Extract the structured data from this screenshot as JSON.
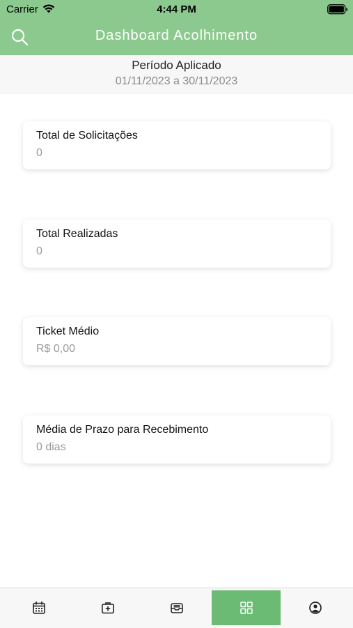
{
  "status_bar": {
    "carrier": "Carrier",
    "time": "4:44 PM"
  },
  "header": {
    "title": "Dashboard Acolhimento",
    "search_icon": "search-icon",
    "background_color": "#8cc98e"
  },
  "period": {
    "label": "Período Aplicado",
    "range": "01/11/2023 a 30/11/2023"
  },
  "cards": [
    {
      "title": "Total de Solicitações",
      "value": "0"
    },
    {
      "title": "Total Realizadas",
      "value": "0"
    },
    {
      "title": "Ticket Médio",
      "value": "R$ 0,00"
    },
    {
      "title": "Média de Prazo para Recebimento",
      "value": "0 dias"
    }
  ],
  "tab_bar": {
    "active_index": 3,
    "active_color": "#6bbb74",
    "tabs": [
      {
        "icon": "calendar-icon"
      },
      {
        "icon": "medical-kit-icon"
      },
      {
        "icon": "inbox-icon"
      },
      {
        "icon": "dashboard-grid-icon"
      },
      {
        "icon": "user-profile-icon"
      }
    ]
  }
}
